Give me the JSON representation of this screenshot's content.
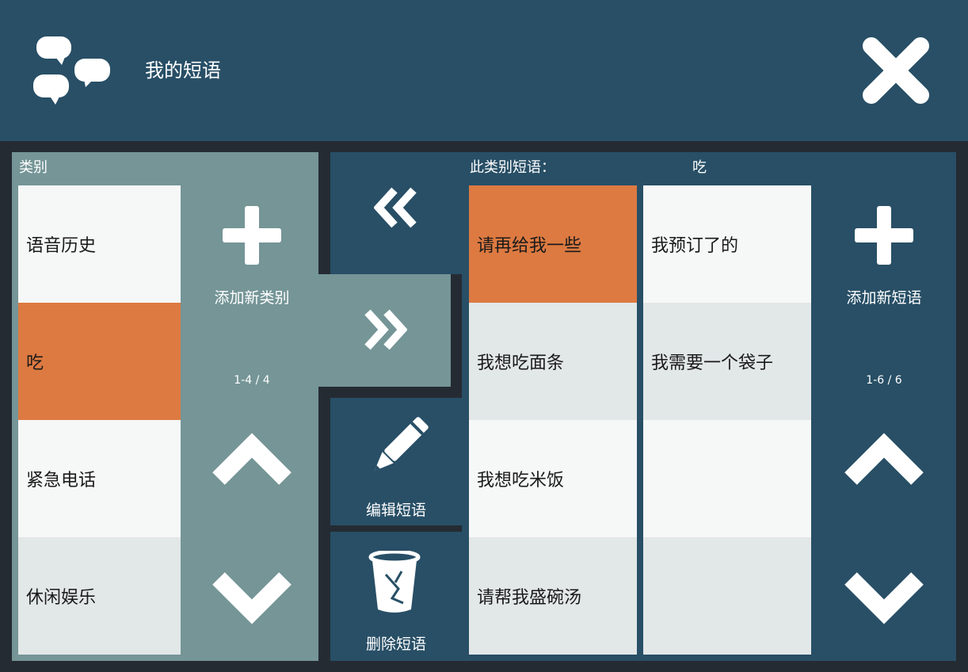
{
  "header": {
    "title": "我的短语",
    "app_icon": "speech-bubbles-icon",
    "close_icon": "close-icon"
  },
  "categories": {
    "heading": "类别",
    "items": [
      {
        "label": "语音历史",
        "selected": false
      },
      {
        "label": "吃",
        "selected": true
      },
      {
        "label": "紧急电话",
        "selected": false
      },
      {
        "label": "休闲娱乐",
        "selected": false
      }
    ],
    "add_label": "添加新类别",
    "counter": "1-4 / 4"
  },
  "phrases": {
    "heading": "此类别短语：",
    "current_category": "吃",
    "column1": [
      "请再给我一些",
      "我想吃面条",
      "我想吃米饭",
      "请帮我盛碗汤"
    ],
    "column2": [
      "我预订了的",
      "我需要一个袋子",
      "",
      ""
    ],
    "selected": "请再给我一些",
    "add_label": "添加新短语",
    "counter": "1-6 / 6",
    "edit_label": "编辑短语",
    "delete_label": "删除短语"
  },
  "colors": {
    "header_bg": "#284f66",
    "category_panel_bg": "#759597",
    "selected_bg": "#dd7a41",
    "page_bg": "#252b33"
  }
}
